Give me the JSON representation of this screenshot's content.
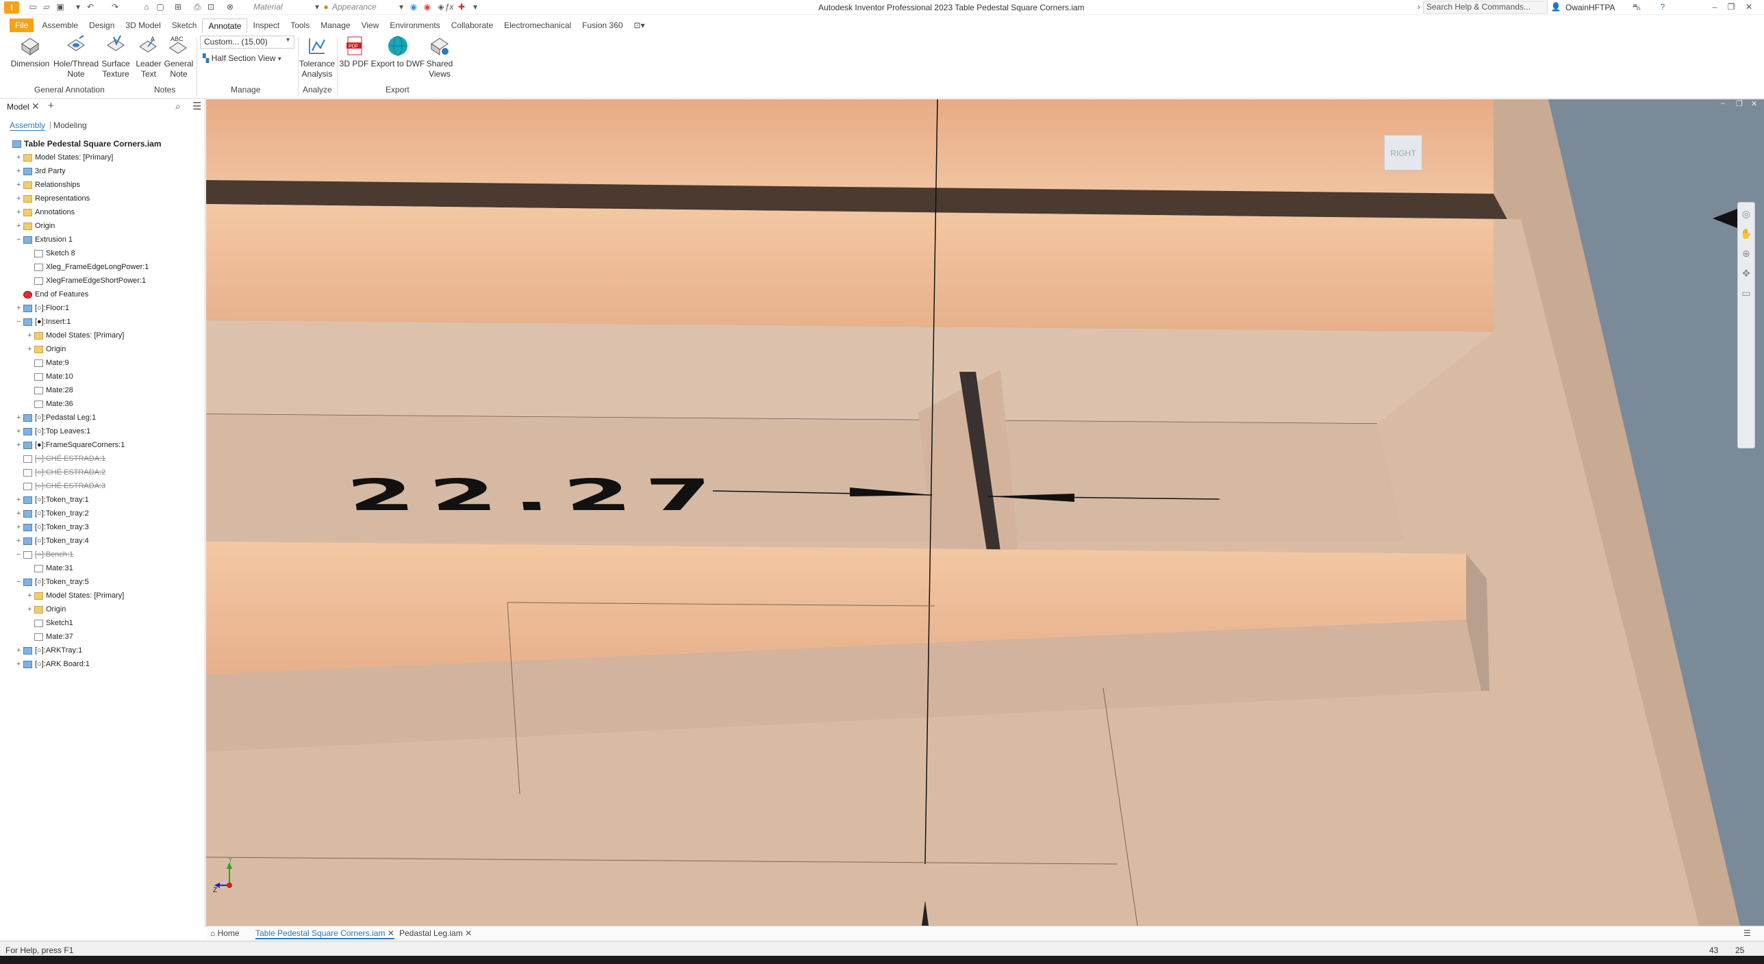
{
  "title_bar": {
    "app_logo": "I",
    "window_title": "Autodesk Inventor Professional 2023   Table Pedestal Square Corners.iam",
    "material_placeholder": "Material",
    "appearance_placeholder": "Appearance",
    "search_placeholder": "Search Help & Commands...",
    "user": "OwainHFTPA",
    "icons": [
      "new-icon",
      "open-icon",
      "save-icon",
      "undo-icon",
      "redo-icon",
      "home-icon",
      "select-icon",
      "measure-icon",
      "update-icon",
      "material-icon",
      "appearance-icon",
      "parameters-icon",
      "fx-icon",
      "add-icon",
      "cart-icon",
      "help-icon",
      "minimize-icon",
      "restore-icon",
      "close-icon"
    ]
  },
  "ribbon": {
    "tabs": [
      {
        "label": "File"
      },
      {
        "label": "Assemble"
      },
      {
        "label": "Design"
      },
      {
        "label": "3D Model"
      },
      {
        "label": "Sketch"
      },
      {
        "label": "Annotate",
        "active": true
      },
      {
        "label": "Inspect"
      },
      {
        "label": "Tools"
      },
      {
        "label": "Manage"
      },
      {
        "label": "View"
      },
      {
        "label": "Environments"
      },
      {
        "label": "Collaborate"
      },
      {
        "label": "Electromechanical"
      },
      {
        "label": "Fusion 360"
      }
    ],
    "buttons": {
      "dimension": "Dimension",
      "hole_thread_1": "Hole/Thread",
      "hole_thread_2": "Note",
      "surface_1": "Surface",
      "surface_2": "Texture",
      "leader_1": "Leader",
      "leader_2": "Text",
      "general_1": "General",
      "general_2": "Note",
      "general_abc": "ABC",
      "tolerance_1": "Tolerance",
      "tolerance_2": "Analysis",
      "pdf3d": "3D PDF",
      "pdf_badge": "PDF",
      "dwf": "Export to DWF",
      "shared_1": "Shared",
      "shared_2": "Views"
    },
    "combo_value": "Custom... (15.00)",
    "half_section": "Half Section View",
    "groups": {
      "general_annotation": "General Annotation",
      "notes": "Notes",
      "manage": "Manage",
      "analyze": "Analyze",
      "export": "Export"
    }
  },
  "browser": {
    "tab": "Model",
    "subtabs": [
      "Assembly",
      "Modeling"
    ],
    "tree": [
      {
        "label": "Table Pedestal Square Corners.iam",
        "indent": 0,
        "icon": "part",
        "bold": true
      },
      {
        "label": "Model States: [Primary]",
        "indent": 1,
        "icon": "folder",
        "expand": "+"
      },
      {
        "label": "3rd Party",
        "indent": 1,
        "icon": "part",
        "expand": "+"
      },
      {
        "label": "Relationships",
        "indent": 1,
        "icon": "folder",
        "expand": "+"
      },
      {
        "label": "Representations",
        "indent": 1,
        "icon": "folder",
        "expand": "+"
      },
      {
        "label": "Annotations",
        "indent": 1,
        "icon": "folder",
        "expand": "+"
      },
      {
        "label": "Origin",
        "indent": 1,
        "icon": "folder",
        "expand": "+"
      },
      {
        "label": "Extrusion 1",
        "indent": 1,
        "icon": "part",
        "expand": "−"
      },
      {
        "label": "Sketch 8",
        "indent": 2,
        "icon": "sk"
      },
      {
        "label": "Xleg_FrameEdgeLongPower:1",
        "indent": 2,
        "icon": "sk"
      },
      {
        "label": "XlegFrameEdgeShortPower:1",
        "indent": 2,
        "icon": "sk"
      },
      {
        "label": "End of Features",
        "indent": 1,
        "icon": "err"
      },
      {
        "label": "[○]:Floor:1",
        "indent": 1,
        "icon": "part",
        "expand": "+"
      },
      {
        "label": "[●]:Insert:1",
        "indent": 1,
        "icon": "part",
        "expand": "−"
      },
      {
        "label": "Model States: [Primary]",
        "indent": 2,
        "icon": "folder",
        "expand": "+"
      },
      {
        "label": "Origin",
        "indent": 2,
        "icon": "folder",
        "expand": "+"
      },
      {
        "label": "Mate:9",
        "indent": 2,
        "icon": "sk"
      },
      {
        "label": "Mate:10",
        "indent": 2,
        "icon": "sk"
      },
      {
        "label": "Mate:28",
        "indent": 2,
        "icon": "sk"
      },
      {
        "label": "Mate:36",
        "indent": 2,
        "icon": "sk"
      },
      {
        "label": "[○]:Pedastal Leg:1",
        "indent": 1,
        "icon": "part",
        "expand": "+"
      },
      {
        "label": "[○]:Top Leaves:1",
        "indent": 1,
        "icon": "part",
        "expand": "+"
      },
      {
        "label": "[●]:FrameSquareCorners:1",
        "indent": 1,
        "icon": "part",
        "expand": "+"
      },
      {
        "label": "[○]:CHÉ ESTRADA:1",
        "indent": 1,
        "icon": "sk",
        "strike": true
      },
      {
        "label": "[○]:CHÉ ESTRADA:2",
        "indent": 1,
        "icon": "sk",
        "strike": true
      },
      {
        "label": "[○]:CHÉ ESTRADA:3",
        "indent": 1,
        "icon": "sk",
        "strike": true
      },
      {
        "label": "[○]:Token_tray:1",
        "indent": 1,
        "icon": "part",
        "expand": "+"
      },
      {
        "label": "[○]:Token_tray:2",
        "indent": 1,
        "icon": "part",
        "expand": "+"
      },
      {
        "label": "[○]:Token_tray:3",
        "indent": 1,
        "icon": "part",
        "expand": "+"
      },
      {
        "label": "[○]:Token_tray:4",
        "indent": 1,
        "icon": "part",
        "expand": "+"
      },
      {
        "label": "[○]:Bench:1",
        "indent": 1,
        "icon": "sk",
        "strike": true,
        "expand": "−"
      },
      {
        "label": "Mate:31",
        "indent": 2,
        "icon": "sk"
      },
      {
        "label": "[○]:Token_tray:5",
        "indent": 1,
        "icon": "part",
        "expand": "−"
      },
      {
        "label": "Model States: [Primary]",
        "indent": 2,
        "icon": "folder",
        "expand": "+"
      },
      {
        "label": "Origin",
        "indent": 2,
        "icon": "folder",
        "expand": "+"
      },
      {
        "label": "Sketch1",
        "indent": 2,
        "icon": "sk"
      },
      {
        "label": "Mate:37",
        "indent": 2,
        "icon": "sk"
      },
      {
        "label": "[○]:ARKTray:1",
        "indent": 1,
        "icon": "part",
        "expand": "+"
      },
      {
        "label": "[○]:ARK Board:1",
        "indent": 1,
        "icon": "part",
        "expand": "+"
      }
    ]
  },
  "viewport": {
    "dimension_value": "22.27",
    "viewcube_face": "RIGHT",
    "axis_labels": {
      "y": "Y",
      "z": "Z"
    }
  },
  "doc_tabs": {
    "home": "Home",
    "tabs": [
      "Table Pedestal Square Corners.iam",
      "Pedastal Leg.iam"
    ]
  },
  "status": {
    "text": "For Help, press F1",
    "n1": "43",
    "n2": "25"
  },
  "colors": {
    "accent": "#2a7ab8",
    "file_tab": "#f4a21a",
    "wood_light": "#e9b08a",
    "wood_face": "#d8b9a1"
  }
}
